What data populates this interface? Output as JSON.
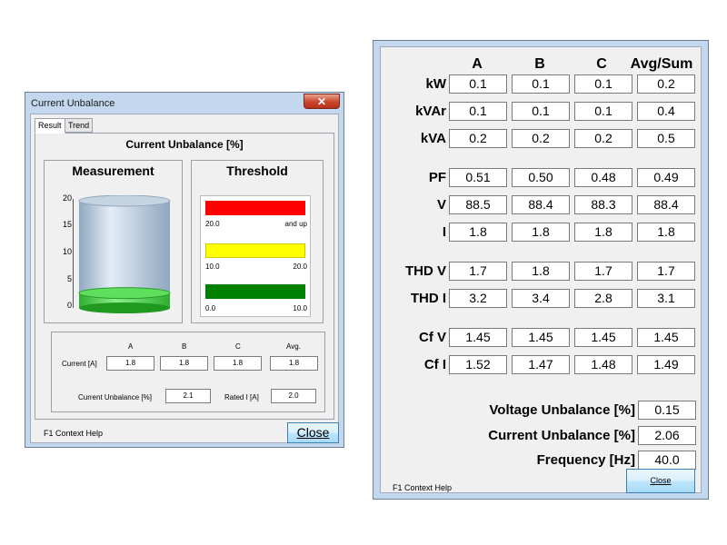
{
  "current_unbalance_dialog": {
    "title": "Current Unbalance",
    "close_glyph": "✕",
    "tabs": [
      "Result",
      "Trend"
    ],
    "panel_title": "Current Unbalance [%]",
    "measurement": {
      "heading": "Measurement",
      "axis_ticks": [
        "20",
        "15",
        "10",
        "5",
        "0"
      ],
      "level_value": 2.1,
      "axis_max": 20
    },
    "threshold": {
      "heading": "Threshold",
      "bands": [
        {
          "color": "#ff0000",
          "low": "20.0",
          "high": "and up"
        },
        {
          "color": "#ffff00",
          "low": "10.0",
          "high": "20.0"
        },
        {
          "color": "#008000",
          "low": "0.0",
          "high": "10.0"
        }
      ]
    },
    "table": {
      "columns": [
        "A",
        "B",
        "C",
        "Avg."
      ],
      "current_label": "Current [A]",
      "current_values": [
        "1.8",
        "1.8",
        "1.8",
        "1.8"
      ],
      "unbalance_label": "Current Unbalance [%]",
      "unbalance_value": "2.1",
      "rated_label": "Rated I [A]",
      "rated_value": "2.0"
    },
    "status": "F1 Context Help",
    "close_label": "Close"
  },
  "power_dialog": {
    "columns": [
      "A",
      "B",
      "C",
      "Avg/Sum"
    ],
    "rows": [
      {
        "label": "kW",
        "values": [
          "0.1",
          "0.1",
          "0.1",
          "0.2"
        ]
      },
      {
        "label": "kVAr",
        "values": [
          "0.1",
          "0.1",
          "0.1",
          "0.4"
        ]
      },
      {
        "label": "kVA",
        "values": [
          "0.2",
          "0.2",
          "0.2",
          "0.5"
        ]
      },
      {
        "label": "PF",
        "values": [
          "0.51",
          "0.50",
          "0.48",
          "0.49"
        ]
      },
      {
        "label": "V",
        "values": [
          "88.5",
          "88.4",
          "88.3",
          "88.4"
        ]
      },
      {
        "label": "I",
        "values": [
          "1.8",
          "1.8",
          "1.8",
          "1.8"
        ]
      },
      {
        "label": "THD V",
        "values": [
          "1.7",
          "1.8",
          "1.7",
          "1.7"
        ]
      },
      {
        "label": "THD I",
        "values": [
          "3.2",
          "3.4",
          "2.8",
          "3.1"
        ]
      },
      {
        "label": "Cf V",
        "values": [
          "1.45",
          "1.45",
          "1.45",
          "1.45"
        ]
      },
      {
        "label": "Cf I",
        "values": [
          "1.52",
          "1.47",
          "1.48",
          "1.49"
        ]
      }
    ],
    "summary": [
      {
        "label": "Voltage Unbalance [%]",
        "value": "0.15"
      },
      {
        "label": "Current Unbalance [%]",
        "value": "2.06"
      },
      {
        "label": "Frequency [Hz]",
        "value": "40.0"
      }
    ],
    "status": "F1 Context Help",
    "close_label": "Close"
  }
}
